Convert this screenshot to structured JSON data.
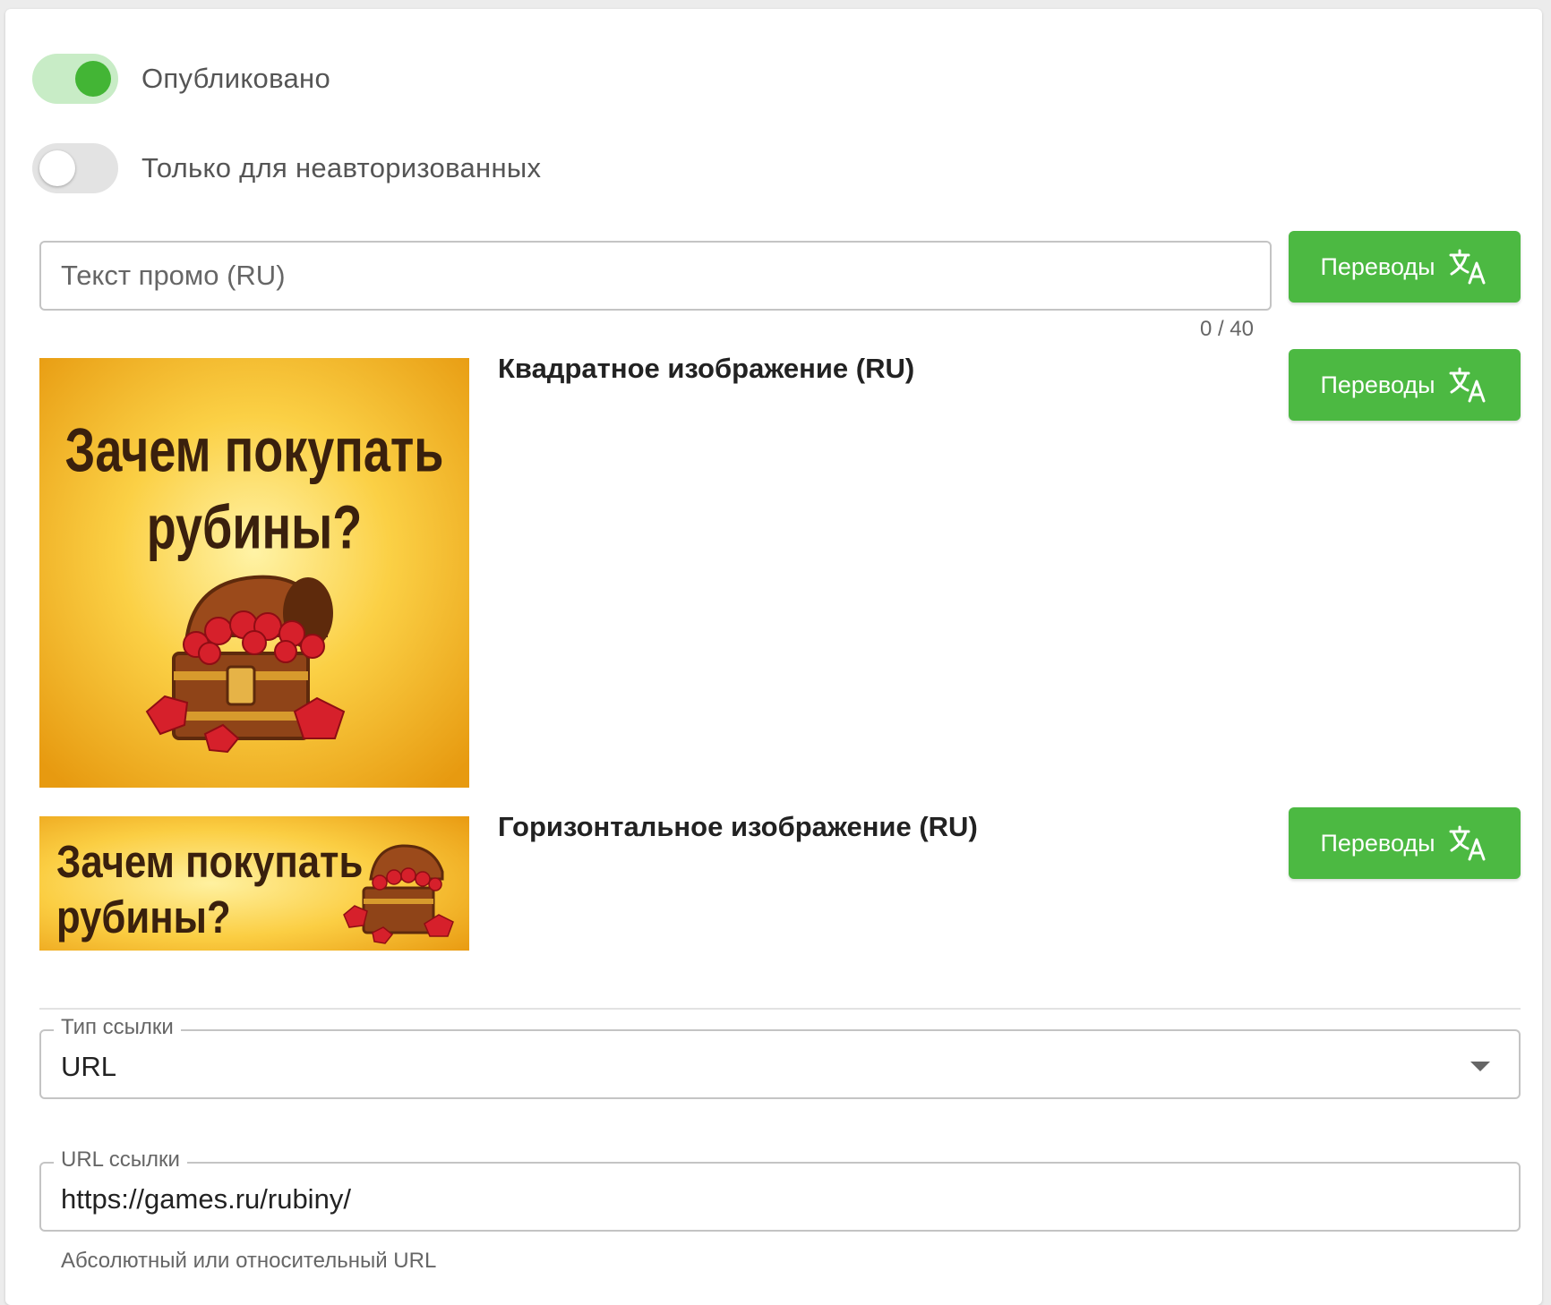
{
  "toggles": {
    "published": {
      "label": "Опубликовано",
      "checked": true
    },
    "guests_only": {
      "label": "Только для неавторизованных",
      "checked": false
    }
  },
  "promo_text": {
    "placeholder": "Текст промо (RU)",
    "value": "",
    "counter": "0 / 40"
  },
  "translations_button_label": "Переводы",
  "square_image": {
    "title": "Квадратное изображение (RU)",
    "banner_line1": "Зачем покупать",
    "banner_line2": "рубины?"
  },
  "horizontal_image": {
    "title": "Горизонтальное изображение (RU)",
    "banner_line1": "Зачем покупать",
    "banner_line2": "рубины?"
  },
  "link_type": {
    "label": "Тип ссылки",
    "value": "URL"
  },
  "link_url": {
    "label": "URL ссылки",
    "value": "https://games.ru/rubiny/",
    "helper": "Абсолютный или относительный URL"
  },
  "colors": {
    "accent_green": "#4cb942",
    "switch_on_track": "#c8ecc6",
    "switch_on_knob": "#43b535",
    "border": "#c4c4c4"
  },
  "icons": {
    "translate": "translate-icon",
    "dropdown": "dropdown-arrow-icon",
    "treasure": "treasure-chest-icon"
  }
}
